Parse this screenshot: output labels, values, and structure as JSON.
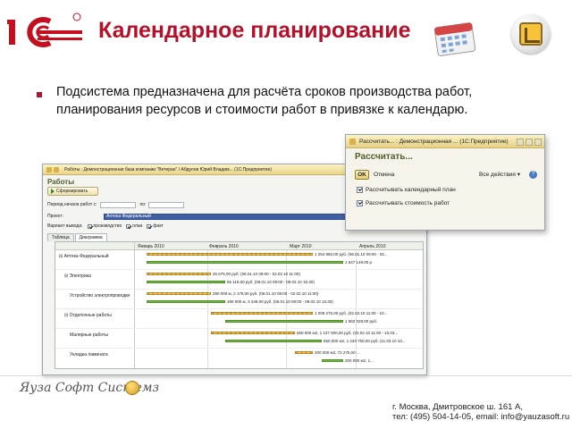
{
  "slide": {
    "title": "Календарное планирование",
    "description": "Подсистема предназначена для расчёта сроков производства работ, планирования ресурсов и стоимости работ в привязке к календарю."
  },
  "main_window": {
    "title_bar": "Работы : Демонстрационная база компании \"Ветеран\" / Абдулов Юрий Владим... (1С:Предприятие)",
    "heading": "Работы",
    "generate_button": "Сформировать",
    "period_label": "Период начала работ с:",
    "period_from": "",
    "period_to_label": "по:",
    "period_to": "",
    "project_label": "Проект:",
    "project_value": "Аптека Федеральный",
    "output_variant_label": "Вариант вывода:",
    "output_options": [
      "производство",
      "план",
      "факт"
    ],
    "tabs": [
      "Таблица",
      "Диаграмма"
    ],
    "active_tab": "Диаграмма",
    "months": [
      "Январь 2010",
      "Февраль 2010",
      "Март 2010",
      "Апрель 2010"
    ],
    "rows": [
      {
        "name": "⊟ Аптека Федеральный",
        "label1": "1 254 950,00 руб. (06.01.10 09:00 - 02...",
        "label2": "1 647 149,00 р."
      },
      {
        "name": "⊟ Электрика",
        "label1": "45 675,00 руб. (06.01.10 09:00 - 02.02.10 11:00)",
        "label2": "65 119,00 руб. (06.01.10 09:00 - 09.02.10 15:30)"
      },
      {
        "name": "Устройство электропроводки",
        "label1": "290 000 м, 2 175,00 руб. (06.01.10 09:00 - 02.02.10 11:00)",
        "label2": "290 000 м, 3 348,00 руб. (06.01.10 09:00 - 09.02.10 15:30)"
      },
      {
        "name": "⊟ Отделочные работы",
        "label1": "1 209 275,00 руб. (02.02.10 11:00 - 10...",
        "label2": "1 582 029,00 руб."
      },
      {
        "name": "Малярные работы",
        "label1": "650 000 м2, 1 137 000,00 руб. (02.02.10 11:00 - 10.03...",
        "label2": "650,000 м2, 1 434 750,00 руб. (11.03.10 13..."
      },
      {
        "name": "Укладка ламината",
        "label1": "200 000 м2, 72 275,00 ...",
        "label2": "200 000 м2, 1..."
      }
    ]
  },
  "dialog": {
    "title_bar": "Рассчитать... : Демонстрационная ... (1С:Предприятие)",
    "heading": "Рассчитать...",
    "ok_button": "OK",
    "cancel_button": "Отмена",
    "all_actions": "Все действия ▾",
    "help": "?",
    "options": [
      {
        "label": "Рассчитывать календарный план",
        "checked": true
      },
      {
        "label": "Рассчитывать стоимость работ",
        "checked": true
      }
    ]
  },
  "footer": {
    "brand": "Яуза Софт Системз",
    "address": "г. Москва, Дмитровское ш. 161 А,",
    "contacts": "тел: (495) 504-14-05, email: info@yauzasoft.ru"
  },
  "colors": {
    "title": "#b3122a",
    "bullet": "#b3122a",
    "window_heading": "#4f5f2a",
    "bar_plan": "#f0a830",
    "bar_fact": "#6fbf3a"
  },
  "icons": [
    "1c-logo-icon",
    "calendar-icon",
    "corner-brand-icon",
    "brand-coin-icon"
  ]
}
